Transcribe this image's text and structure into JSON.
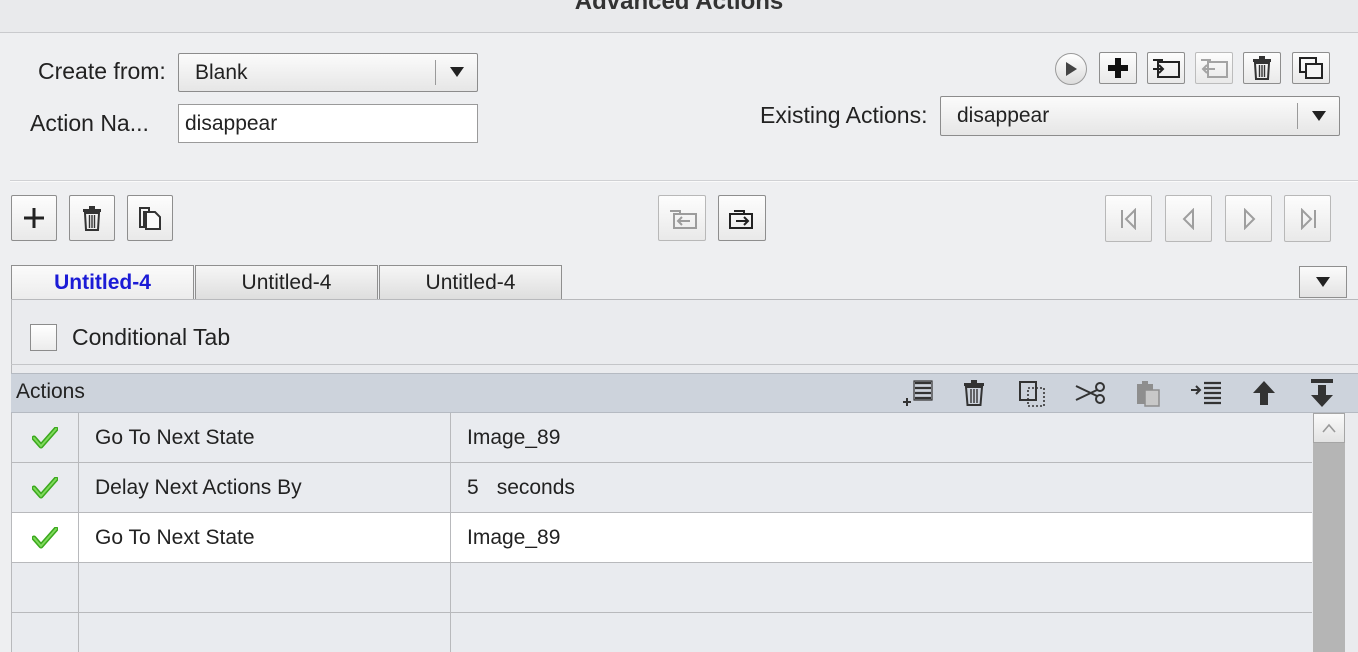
{
  "window": {
    "title": "Advanced Actions"
  },
  "create_from": {
    "label": "Create from:",
    "value": "Blank"
  },
  "action_name": {
    "label": "Action Na...",
    "value": "disappear"
  },
  "existing_actions": {
    "label": "Existing Actions:",
    "value": "disappear"
  },
  "top_toolbar": {
    "icons": [
      "preview-play-icon",
      "add-action-icon",
      "import-icon",
      "export-icon",
      "delete-action-icon",
      "duplicate-action-icon"
    ]
  },
  "block_toolbar": {
    "icons": [
      "add-icon",
      "trash-icon",
      "duplicate-icon",
      "import-block-icon",
      "export-block-icon",
      "first-icon",
      "previous-icon",
      "next-icon",
      "last-icon"
    ]
  },
  "tabs": [
    {
      "label": "Untitled-4",
      "active": true
    },
    {
      "label": "Untitled-4",
      "active": false
    },
    {
      "label": "Untitled-4",
      "active": false
    }
  ],
  "conditional_tab": {
    "label": "Conditional Tab",
    "checked": false
  },
  "actions_grid": {
    "title": "Actions",
    "toolbar_icons": [
      "insert-row-icon",
      "delete-row-icon",
      "copy-row-icon",
      "cut-icon",
      "paste-icon",
      "indent-icon",
      "move-up-icon",
      "move-down-icon"
    ],
    "rows": [
      {
        "status": "check",
        "action": "Go To Next State",
        "target": "Image_89",
        "unit": ""
      },
      {
        "status": "check",
        "action": "Delay Next Actions By",
        "target": "5",
        "unit": "seconds"
      },
      {
        "status": "check",
        "action": "Go To Next State",
        "target": "Image_89",
        "unit": ""
      },
      {
        "status": "",
        "action": "",
        "target": "",
        "unit": ""
      },
      {
        "status": "",
        "action": "",
        "target": "",
        "unit": ""
      }
    ]
  },
  "colors": {
    "active_tab": "#1b1bd6",
    "check": "#3aa81c",
    "header": "#cdd3dc"
  }
}
